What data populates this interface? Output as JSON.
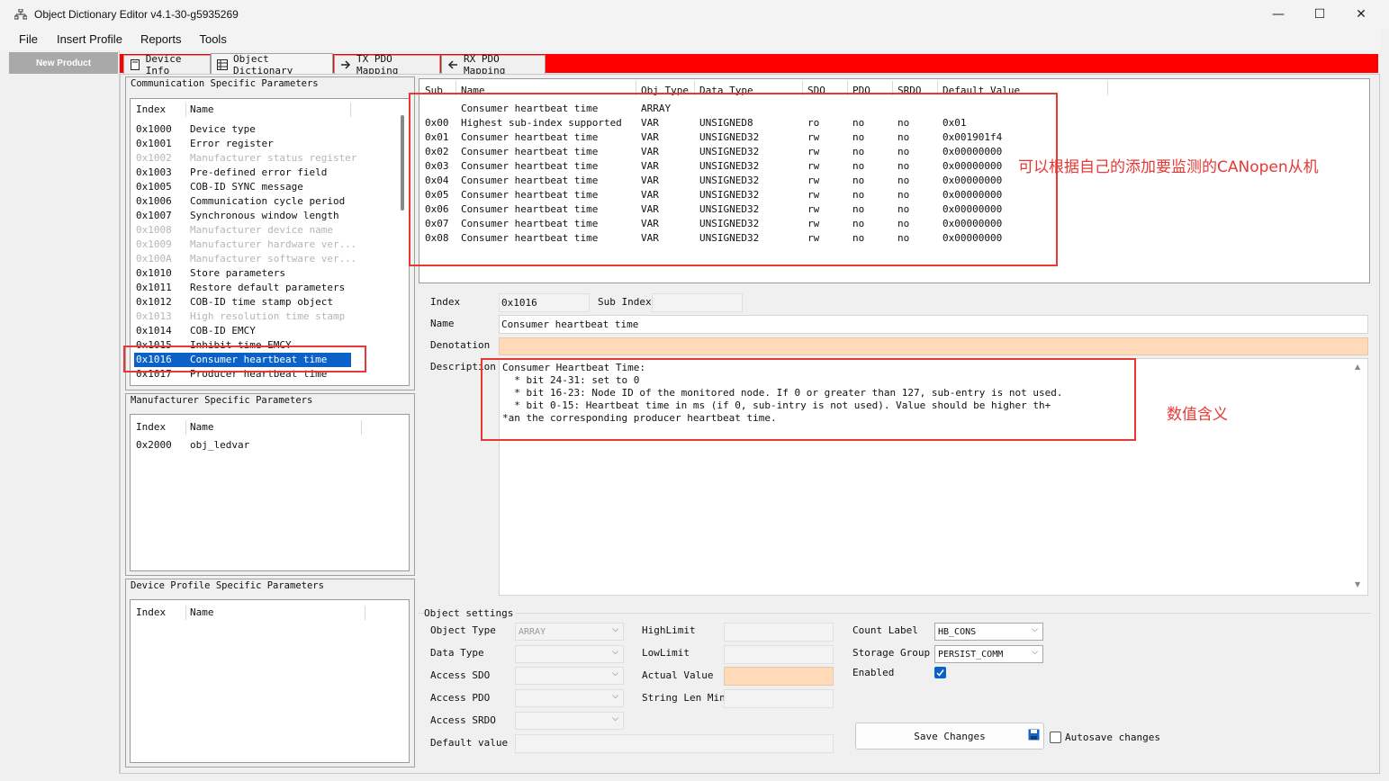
{
  "window": {
    "title": "Object Dictionary Editor v4.1-30-g5935269",
    "minimize_glyph": "—",
    "maximize_glyph": "☐",
    "close_glyph": "✕"
  },
  "menu": [
    "File",
    "Insert Profile",
    "Reports",
    "Tools"
  ],
  "left_nav": {
    "new_product": "New Product"
  },
  "tabs": [
    {
      "label": "Device Info",
      "icon": "document-icon"
    },
    {
      "label": "Object Dictionary",
      "icon": "table-icon"
    },
    {
      "label": "TX PDO Mapping",
      "icon": "arrow-right-icon"
    },
    {
      "label": "RX PDO Mapping",
      "icon": "arrow-left-icon"
    }
  ],
  "comm_params": {
    "title": "Communication Specific Parameters",
    "headers": [
      "Index",
      "Name"
    ],
    "rows": [
      {
        "index": "0x1000",
        "name": "Device type",
        "disabled": false
      },
      {
        "index": "0x1001",
        "name": "Error register",
        "disabled": false
      },
      {
        "index": "0x1002",
        "name": "Manufacturer status register",
        "disabled": true
      },
      {
        "index": "0x1003",
        "name": "Pre-defined error field",
        "disabled": false
      },
      {
        "index": "0x1005",
        "name": "COB-ID SYNC message",
        "disabled": false
      },
      {
        "index": "0x1006",
        "name": "Communication cycle period",
        "disabled": false
      },
      {
        "index": "0x1007",
        "name": "Synchronous window length",
        "disabled": false
      },
      {
        "index": "0x1008",
        "name": "Manufacturer device name",
        "disabled": true
      },
      {
        "index": "0x1009",
        "name": "Manufacturer hardware ver...",
        "disabled": true
      },
      {
        "index": "0x100A",
        "name": "Manufacturer software ver...",
        "disabled": true
      },
      {
        "index": "0x1010",
        "name": "Store parameters",
        "disabled": false
      },
      {
        "index": "0x1011",
        "name": "Restore default parameters",
        "disabled": false
      },
      {
        "index": "0x1012",
        "name": "COB-ID time stamp object",
        "disabled": false
      },
      {
        "index": "0x1013",
        "name": "High resolution time stamp",
        "disabled": true
      },
      {
        "index": "0x1014",
        "name": "COB-ID EMCY",
        "disabled": false
      },
      {
        "index": "0x1015",
        "name": "Inhibit time EMCY",
        "disabled": false
      },
      {
        "index": "0x1016",
        "name": "Consumer heartbeat time",
        "disabled": false,
        "selected": true
      },
      {
        "index": "0x1017",
        "name": "Producer heartbeat time",
        "disabled": false
      }
    ]
  },
  "mfr_params": {
    "title": "Manufacturer Specific Parameters",
    "headers": [
      "Index",
      "Name"
    ],
    "rows": [
      {
        "index": "0x2000",
        "name": "obj_ledvar"
      }
    ]
  },
  "profile_params": {
    "title": "Device Profile Specific Parameters",
    "headers": [
      "Index",
      "Name"
    ]
  },
  "sub_table": {
    "headers": [
      "Sub",
      "Name",
      "Obj Type",
      "Data Type",
      "SDO",
      "PDO",
      "SRDO",
      "Default Value"
    ],
    "rows": [
      {
        "sub": "",
        "name": "Consumer heartbeat time",
        "obj": "ARRAY",
        "dtype": "",
        "sdo": "",
        "pdo": "",
        "srdo": "",
        "def": ""
      },
      {
        "sub": "0x00",
        "name": "Highest sub-index supported",
        "obj": "VAR",
        "dtype": "UNSIGNED8",
        "sdo": "ro",
        "pdo": "no",
        "srdo": "no",
        "def": "0x01"
      },
      {
        "sub": "0x01",
        "name": "Consumer heartbeat time",
        "obj": "VAR",
        "dtype": "UNSIGNED32",
        "sdo": "rw",
        "pdo": "no",
        "srdo": "no",
        "def": "0x001901f4"
      },
      {
        "sub": "0x02",
        "name": "Consumer heartbeat time",
        "obj": "VAR",
        "dtype": "UNSIGNED32",
        "sdo": "rw",
        "pdo": "no",
        "srdo": "no",
        "def": "0x00000000"
      },
      {
        "sub": "0x03",
        "name": "Consumer heartbeat time",
        "obj": "VAR",
        "dtype": "UNSIGNED32",
        "sdo": "rw",
        "pdo": "no",
        "srdo": "no",
        "def": "0x00000000"
      },
      {
        "sub": "0x04",
        "name": "Consumer heartbeat time",
        "obj": "VAR",
        "dtype": "UNSIGNED32",
        "sdo": "rw",
        "pdo": "no",
        "srdo": "no",
        "def": "0x00000000"
      },
      {
        "sub": "0x05",
        "name": "Consumer heartbeat time",
        "obj": "VAR",
        "dtype": "UNSIGNED32",
        "sdo": "rw",
        "pdo": "no",
        "srdo": "no",
        "def": "0x00000000"
      },
      {
        "sub": "0x06",
        "name": "Consumer heartbeat time",
        "obj": "VAR",
        "dtype": "UNSIGNED32",
        "sdo": "rw",
        "pdo": "no",
        "srdo": "no",
        "def": "0x00000000"
      },
      {
        "sub": "0x07",
        "name": "Consumer heartbeat time",
        "obj": "VAR",
        "dtype": "UNSIGNED32",
        "sdo": "rw",
        "pdo": "no",
        "srdo": "no",
        "def": "0x00000000"
      },
      {
        "sub": "0x08",
        "name": "Consumer heartbeat time",
        "obj": "VAR",
        "dtype": "UNSIGNED32",
        "sdo": "rw",
        "pdo": "no",
        "srdo": "no",
        "def": "0x00000000"
      }
    ]
  },
  "details": {
    "index_label": "Index",
    "index_value": "0x1016",
    "subindex_label": "Sub Index",
    "subindex_value": "",
    "name_label": "Name",
    "name_value": "Consumer heartbeat time",
    "denotation_label": "Denotation",
    "denotation_value": "",
    "description_label": "Description",
    "description_lines": [
      "Consumer Heartbeat Time:",
      "  * bit 24-31: set to 0",
      "  * bit 16-23: Node ID of the monitored node. If 0 or greater than 127, sub-entry is not used.",
      "  * bit 0-15: Heartbeat time in ms (if 0, sub-intry is not used). Value should be higher th+",
      "*an the corresponding producer heartbeat time."
    ]
  },
  "object_settings": {
    "title": "Object settings",
    "object_type_label": "Object Type",
    "object_type_value": "ARRAY",
    "data_type_label": "Data Type",
    "data_type_value": "",
    "access_sdo_label": "Access SDO",
    "access_sdo_value": "",
    "access_pdo_label": "Access PDO",
    "access_pdo_value": "",
    "access_srdo_label": "Access SRDO",
    "access_srdo_value": "",
    "default_value_label": "Default value",
    "default_value": "",
    "highlimit_label": "HighLimit",
    "highlimit_value": "",
    "lowlimit_label": "LowLimit",
    "lowlimit_value": "",
    "actual_value_label": "Actual Value",
    "actual_value": "",
    "strlen_label": "String Len Min",
    "strlen_value": "",
    "count_label_label": "Count Label",
    "count_label_value": "HB_CONS",
    "storage_group_label": "Storage Group",
    "storage_group_value": "PERSIST_COMM",
    "enabled_label": "Enabled",
    "enabled": true,
    "save_button": "Save Changes",
    "autosave_label": "Autosave changes",
    "autosave": false
  },
  "annotations": {
    "sub_table_note": "可以根据自己的添加要监测的CANopen从机",
    "description_note": "数值含义"
  },
  "colors": {
    "selection": "#0a62c8",
    "tab_strip": "#ff0000",
    "annotation_red": "#e53935",
    "denotation_orange": "#ffdab9"
  }
}
